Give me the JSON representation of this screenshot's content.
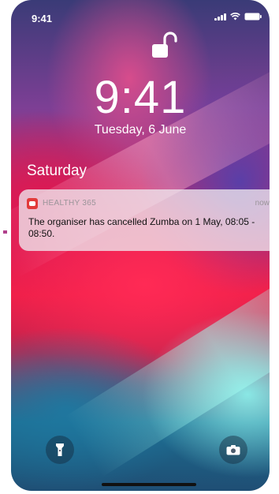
{
  "status_bar": {
    "time": "9:41",
    "icons": [
      "signal-icon",
      "wifi-icon",
      "battery-icon"
    ]
  },
  "lock_screen": {
    "lock_icon": "unlocked-padlock-icon",
    "time": "9:41",
    "date": "Tuesday, 6 June",
    "section_title": "Saturday"
  },
  "notification": {
    "app_icon": "healthy365-app-icon",
    "app_name": "HEALTHY 365",
    "time": "now",
    "message": "The organiser has cancelled Zumba on 1 May, 08:05 - 08:50."
  },
  "quick_actions": {
    "left": "flashlight-icon",
    "right": "camera-icon"
  },
  "colors": {
    "text": "#ffffff",
    "notification_bg": "#eee8ee",
    "notification_meta": "#9a9499"
  }
}
